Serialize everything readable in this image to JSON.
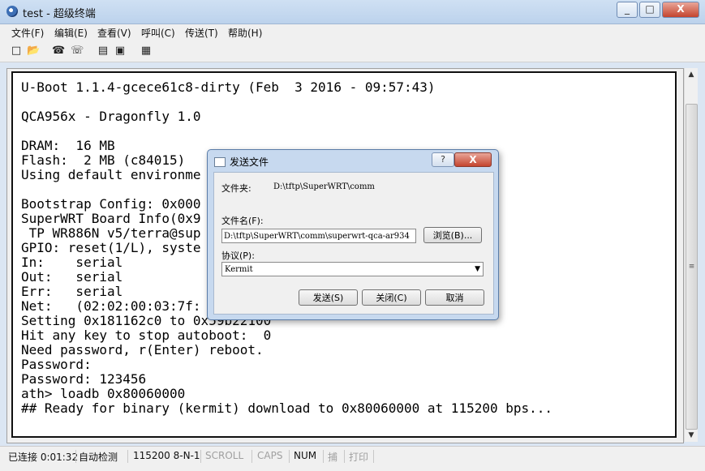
{
  "window": {
    "title": "test - 超级终端",
    "minimize": "_",
    "maximize": "□",
    "close": "X"
  },
  "menu": [
    "文件(F)",
    "编辑(E)",
    "查看(V)",
    "呼叫(C)",
    "传送(T)",
    "帮助(H)"
  ],
  "toolbar": {
    "icons": [
      "new-icon",
      "open-icon",
      "connect-icon",
      "disconnect-icon",
      "send-icon",
      "receive-icon",
      "properties-icon"
    ]
  },
  "terminal": {
    "lines": [
      "U-Boot 1.1.4-gcece61c8-dirty (Feb  3 2016 - 09:57:43)",
      "",
      "QCA956x - Dragonfly 1.0",
      "",
      "DRAM:  16 MB",
      "Flash:  2 MB (c84015)",
      "Using default environme",
      "",
      "Bootstrap Config: 0x000",
      "SuperWRT Board Info(0x9",
      " TP WR886N v5/terra@sup",
      "GPIO: reset(1/L), syste",
      "In:    serial",
      "Out:   serial",
      "Err:   serial",
      "Net:   (02:02:00:03:7f:",
      "Setting 0x181162c0 to 0x59b22100",
      "Hit any key to stop autoboot:  0",
      "Need password, r(Enter) reboot.",
      "Password:",
      "Password: 123456",
      "ath> loadb 0x80060000",
      "## Ready for binary (kermit) download to 0x80060000 at 115200 bps..."
    ]
  },
  "dialog": {
    "title": "发送文件",
    "help": "?",
    "close": "X",
    "folder_label": "文件夹:",
    "folder_value": "D:\\tftp\\SuperWRT\\comm",
    "filename_label": "文件名(F):",
    "filename_value": "D:\\tftp\\SuperWRT\\comm\\superwrt-qca-ar934",
    "browse": "浏览(B)...",
    "protocol_label": "协议(P):",
    "protocol_value": "Kermit",
    "send": "发送(S)",
    "close_btn": "关闭(C)",
    "cancel": "取消"
  },
  "status": {
    "connected": "已连接 0:01:32",
    "detect": "自动检测",
    "params": "115200 8-N-1",
    "scroll": "SCROLL",
    "caps": "CAPS",
    "num": "NUM",
    "capture": "捕",
    "print": "打印"
  }
}
